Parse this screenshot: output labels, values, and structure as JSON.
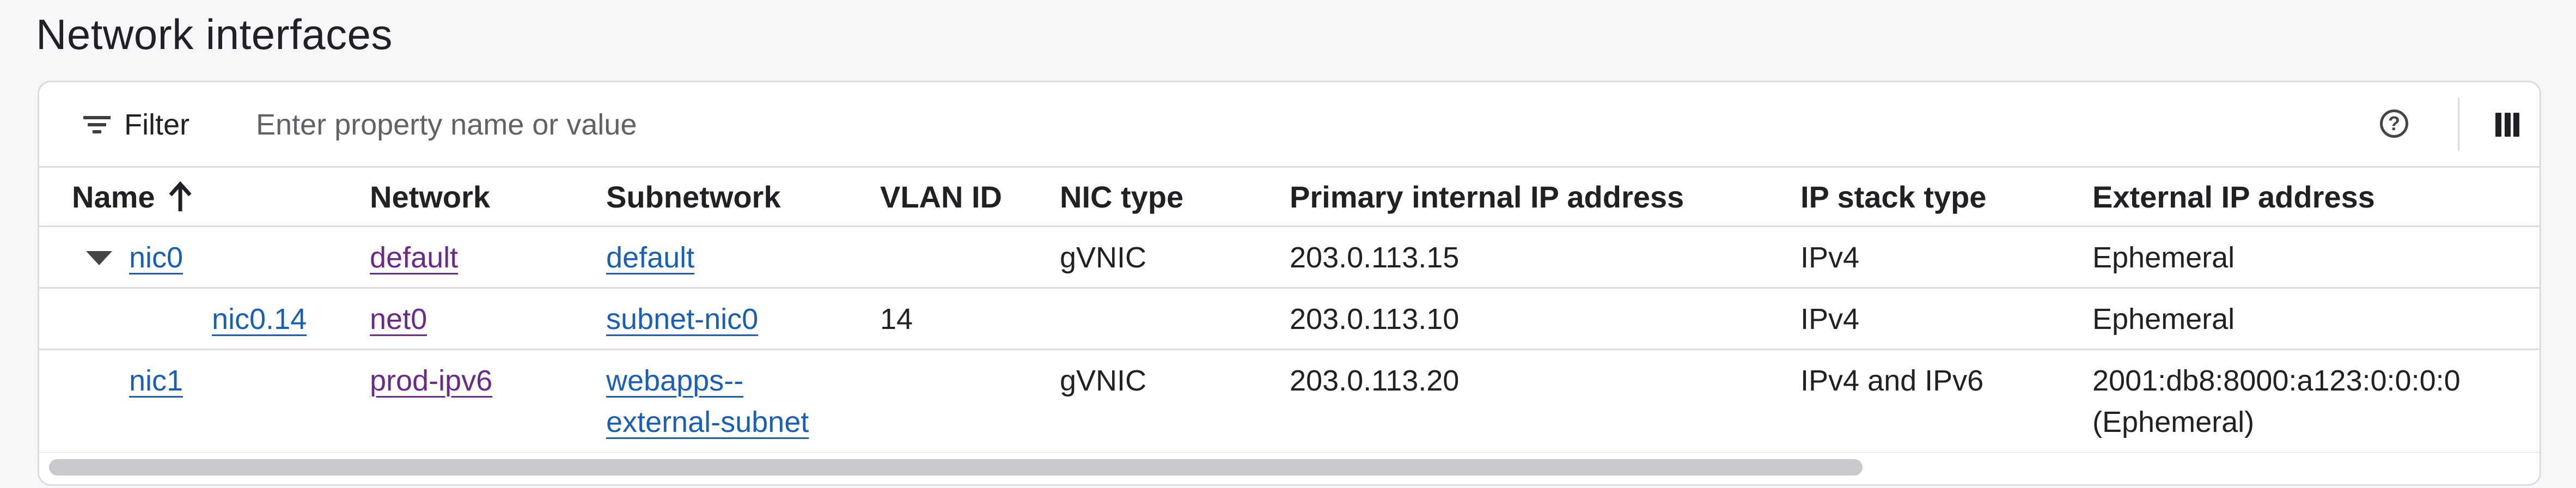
{
  "section_title": "Network interfaces",
  "filter": {
    "label": "Filter",
    "placeholder": "Enter property name or value",
    "value": ""
  },
  "icons": {
    "filter": "filter-list-icon",
    "help": "help-circle-icon",
    "help_glyph": "?",
    "columns": "column-display-icon",
    "sort": "arrow-up-icon",
    "expand": "expand-more-icon"
  },
  "table": {
    "sort_column": "Name",
    "sort_direction": "ascending",
    "headers": {
      "name": "Name",
      "network": "Network",
      "subnetwork": "Subnetwork",
      "vlan_id": "VLAN ID",
      "nic_type": "NIC type",
      "primary_ip": "Primary internal IP address",
      "ip_stack": "IP stack type",
      "external_ip": "External IP address"
    },
    "rows": [
      {
        "name": "nic0",
        "expanded": true,
        "network": "default",
        "subnetwork": "default",
        "vlan_id": "",
        "nic_type": "gVNIC",
        "primary_ip": "203.0.113.15",
        "ip_stack": "IPv4",
        "external_ip": "Ephemeral",
        "external_ip_2": ""
      },
      {
        "name": "nic0.14",
        "network": "net0",
        "subnetwork": "subnet-nic0",
        "vlan_id": "14",
        "nic_type": "",
        "primary_ip": "203.0.113.10",
        "ip_stack": "IPv4",
        "external_ip": "Ephemeral",
        "external_ip_2": ""
      },
      {
        "name": "nic1",
        "network": "prod-ipv6",
        "subnetwork": "webapps--",
        "subnetwork_2": "external-subnet",
        "vlan_id": "",
        "nic_type": "gVNIC",
        "primary_ip": "203.0.113.20",
        "ip_stack": "IPv4 and IPv6",
        "external_ip": "2001:db8:8000:a123:0:0:0:0",
        "external_ip_2": "(Ephemeral)"
      }
    ]
  },
  "colors": {
    "link": "#1a5fb4",
    "visited_link": "#6b2a8a",
    "border": "#dadce0",
    "text": "#202124",
    "background": "#f6f7f8"
  }
}
